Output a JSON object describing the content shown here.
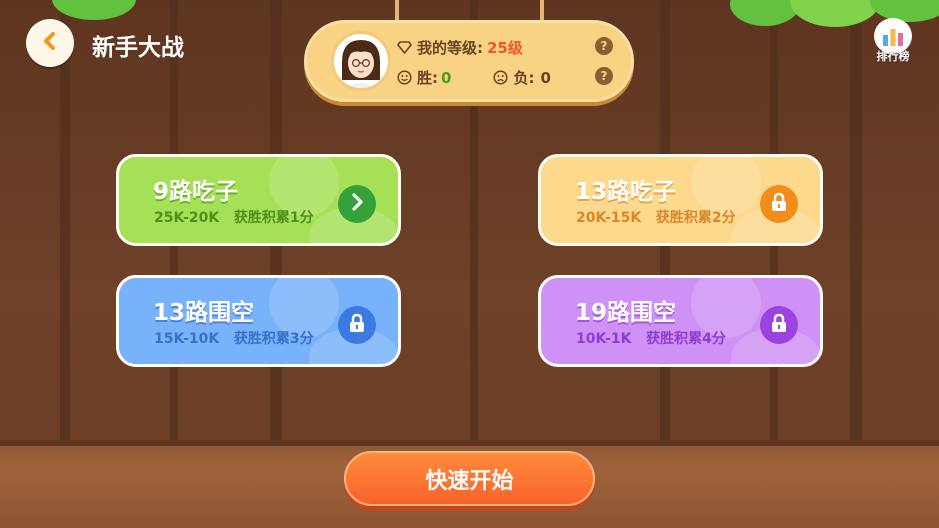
{
  "header": {
    "title": "新手大战"
  },
  "profile": {
    "level_label": "我的等级:",
    "level_value": "25级",
    "wins_label": "胜:",
    "wins_value": "0",
    "losses_label": "负:",
    "losses_value": "0",
    "help_glyph": "?"
  },
  "leaderboard": {
    "label": "排行榜"
  },
  "modes": [
    {
      "title": "9路吃子",
      "rank_range": "25K-20K",
      "reward": "获胜积累1分",
      "state": "unlocked",
      "icon": "chevron-right-icon"
    },
    {
      "title": "13路吃子",
      "rank_range": "20K-15K",
      "reward": "获胜积累2分",
      "state": "locked",
      "icon": "lock-icon"
    },
    {
      "title": "13路围空",
      "rank_range": "15K-10K",
      "reward": "获胜积累3分",
      "state": "locked",
      "icon": "lock-icon"
    },
    {
      "title": "19路围空",
      "rank_range": "10K-1K",
      "reward": "获胜积累4分",
      "state": "locked",
      "icon": "lock-icon"
    }
  ],
  "start_button": {
    "label": "快速开始"
  },
  "colors": {
    "green_card": "#a6e056",
    "orange_card": "#fcd98c",
    "blue_card": "#78b2fb",
    "purple_card": "#cf91f5",
    "level_accent": "#f0582a",
    "wins_accent": "#4a9e1c",
    "start_button": "#f9622a"
  }
}
